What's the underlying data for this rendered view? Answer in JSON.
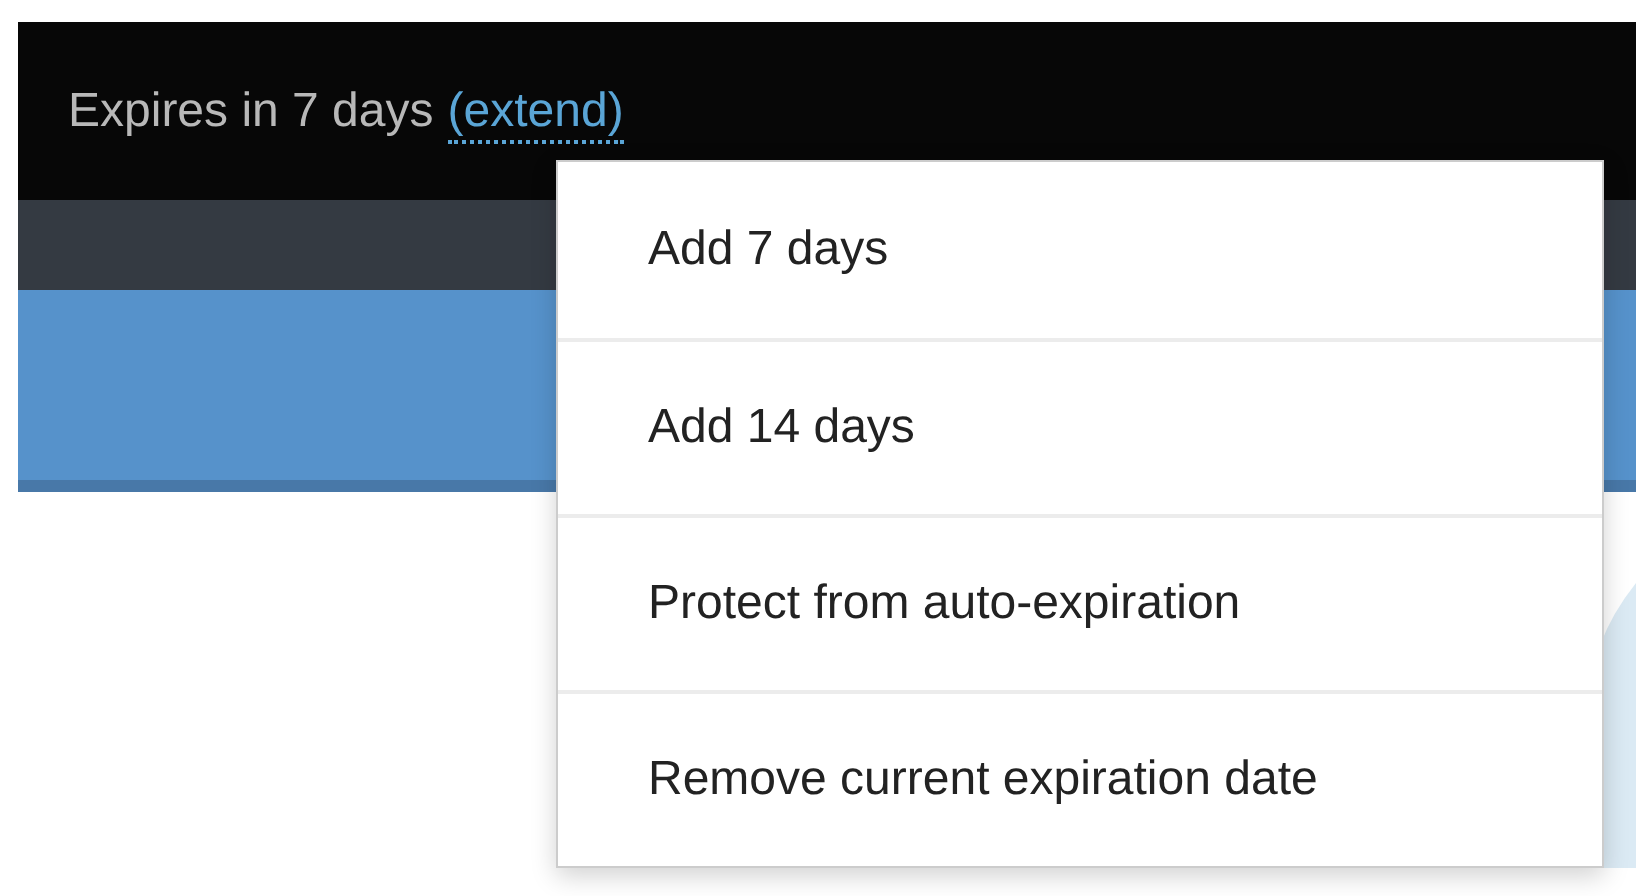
{
  "header": {
    "status": "Expires in 7 days",
    "link": "(extend)"
  },
  "menu": {
    "items": [
      {
        "label": "Add 7 days"
      },
      {
        "label": "Add 14 days"
      },
      {
        "label": "Protect from auto-expiration"
      },
      {
        "label": "Remove current expiration date"
      }
    ]
  }
}
